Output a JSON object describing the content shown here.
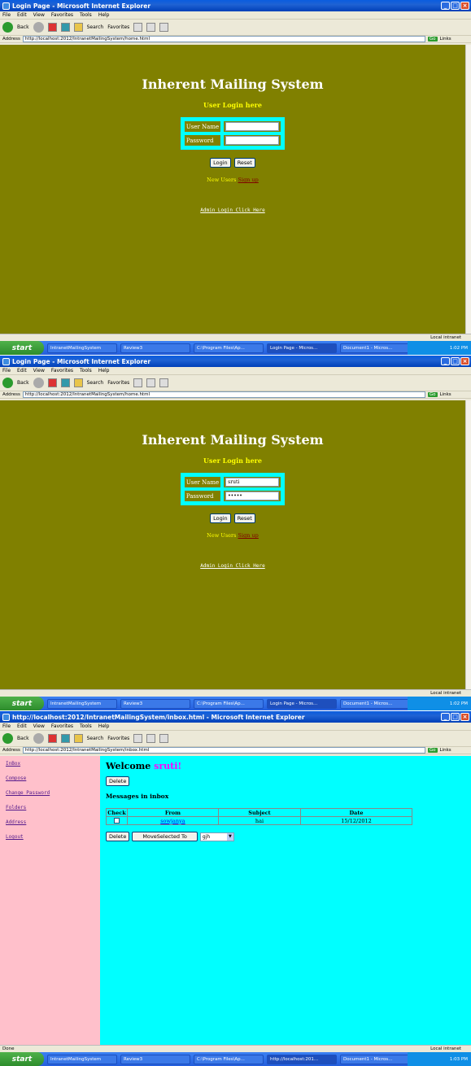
{
  "login_shots": [
    {
      "window_title": "Login Page - Microsoft Internet Explorer",
      "address": "http://localhost:2012/IntranetMailingSystem/home.html",
      "username_value": "",
      "password_value": ""
    },
    {
      "window_title": "Login Page - Microsoft Internet Explorer",
      "address": "http://localhost:2012/IntranetMailingSystem/home.html",
      "username_value": "sruti",
      "password_value": "•••••"
    }
  ],
  "browser": {
    "menu": [
      "File",
      "Edit",
      "View",
      "Favorites",
      "Tools",
      "Help"
    ],
    "back_label": "Back",
    "search_label": "Search",
    "favorites_label": "Favorites",
    "address_label": "Address",
    "go_label": "Go",
    "links_label": "Links",
    "status_zone": "Local intranet"
  },
  "login_page": {
    "heading": "Inherent Mailing System",
    "subheading": "User Login here",
    "username_label": "User Name",
    "password_label": "Password",
    "login_button": "Login",
    "reset_button": "Reset",
    "new_user_text": "New Users",
    "signup_link": "Sign up",
    "admin_link": "Admin Login Click Here"
  },
  "taskbar": {
    "start": "start",
    "tasks": [
      "IntranetMailingSystem",
      "Review3",
      "C:\\Program Files\\Ap...",
      "Login Page - Micros...",
      "Document1 - Micros..."
    ],
    "clock_1": "1:02 PM",
    "clock_2": "1:02 PM",
    "clock_3": "1:03 PM",
    "task_active_3": "http://localhost:201..."
  },
  "inbox_shot": {
    "window_title": "http://localhost:2012/IntranetMailingSystem/inbox.html - Microsoft Internet Explorer",
    "address": "http://localhost:2012/IntranetMailingSystem/inbox.html",
    "status_left": "Done",
    "sidebar": [
      "InBox",
      "Compose",
      "Change Password",
      "Folders",
      "Address",
      "Logout"
    ],
    "welcome": "Welcome",
    "username": "sruti!",
    "delete_top": "Delete",
    "messages_heading": "Messages in inbox",
    "columns": [
      "Check",
      "From",
      "Subject",
      "Date"
    ],
    "rows": [
      {
        "from": "sowjanya",
        "subject": "hai",
        "date": "15/12/2012"
      }
    ],
    "delete_bottom": "Delete",
    "move_button": "MoveSelected To",
    "folder_option": "gjh"
  }
}
